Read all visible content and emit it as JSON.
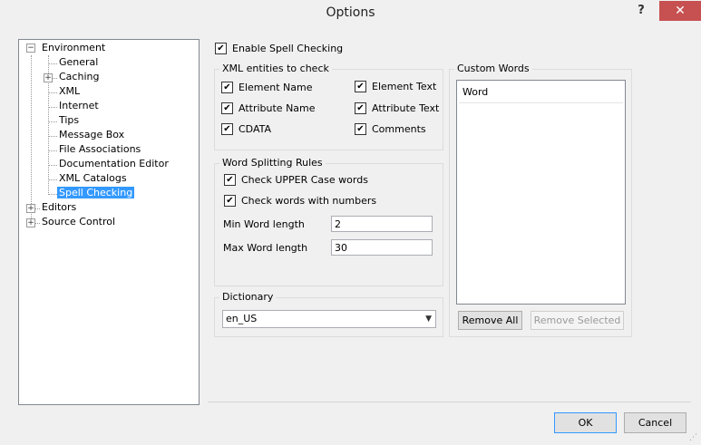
{
  "window": {
    "title": "Options",
    "help_label": "?",
    "close_label": "✕"
  },
  "tree": {
    "items": [
      {
        "label": "Environment"
      },
      {
        "label": "General"
      },
      {
        "label": "Caching"
      },
      {
        "label": "XML"
      },
      {
        "label": "Internet"
      },
      {
        "label": "Tips"
      },
      {
        "label": "Message Box"
      },
      {
        "label": "File Associations"
      },
      {
        "label": "Documentation Editor"
      },
      {
        "label": "XML Catalogs"
      },
      {
        "label": "Spell Checking",
        "selected": true
      },
      {
        "label": "Editors"
      },
      {
        "label": "Source Control"
      }
    ]
  },
  "spell": {
    "enable_label": "Enable Spell Checking",
    "xml_group_label": "XML entities to check",
    "xml_checks": [
      {
        "label": "Element Name"
      },
      {
        "label": "Element Text"
      },
      {
        "label": "Attribute Name"
      },
      {
        "label": "Attribute Text"
      },
      {
        "label": "CDATA"
      },
      {
        "label": "Comments"
      }
    ],
    "word_group_label": "Word Splitting Rules",
    "upper_label": "Check UPPER Case words",
    "numbers_label": "Check words with numbers",
    "min_label": "Min Word length",
    "min_value": "2",
    "max_label": "Max Word length",
    "max_value": "30",
    "dict_group_label": "Dictionary",
    "dict_value": "en_US"
  },
  "custom": {
    "group_label": "Custom Words",
    "words": [
      "Word"
    ],
    "remove_all_label": "Remove All",
    "remove_selected_label": "Remove Selected"
  },
  "footer": {
    "ok_label": "OK",
    "cancel_label": "Cancel"
  },
  "icons": {
    "check": "✔",
    "expand": "+",
    "collapse": "−",
    "dropdown": "▼"
  }
}
